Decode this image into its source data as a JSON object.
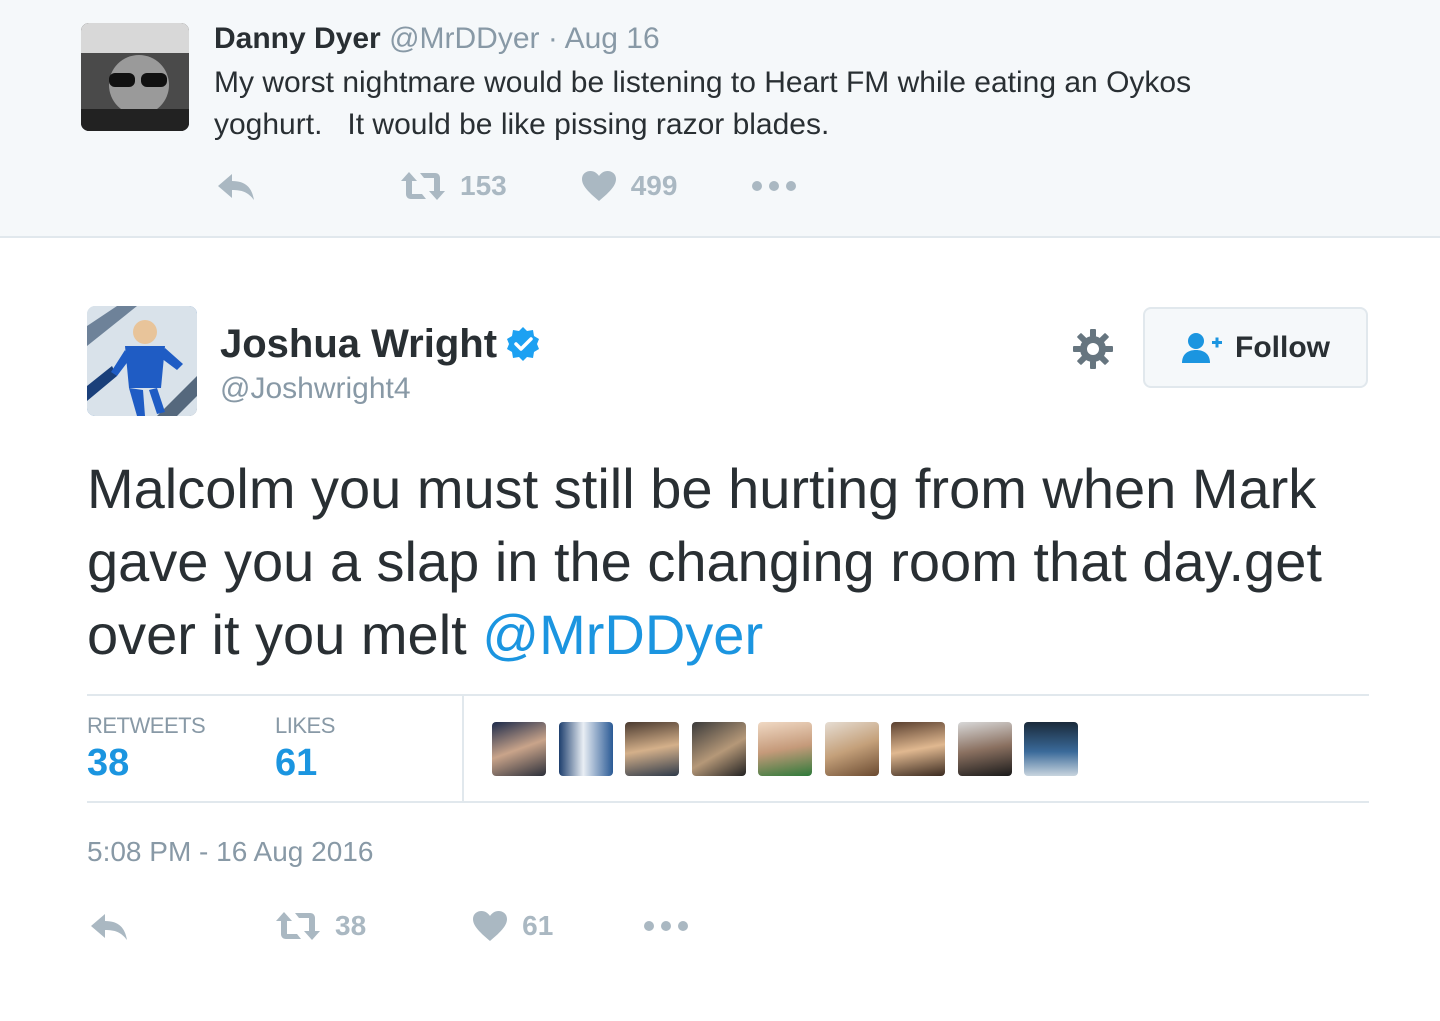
{
  "parent_tweet": {
    "name": "Danny Dyer",
    "handle": "@MrDDyer",
    "separator": "·",
    "date": "Aug 16",
    "text": "My worst nightmare would be listening to Heart FM while eating an Oykos\nyoghurt.   It would be like pissing razor blades.",
    "retweet_count": "153",
    "like_count": "499",
    "icons": [
      "reply-icon",
      "retweet-icon",
      "heart-icon",
      "more-icon"
    ]
  },
  "main_tweet": {
    "name": "Joshua Wright",
    "verified": true,
    "handle": "@Joshwright4",
    "follow_label": "Follow",
    "text": "Malcolm you must still be hurting from when Mark gave you a slap in the changing room that day.get over it you melt ",
    "mention": "@MrDDyer",
    "stats": {
      "retweets_label": "RETWEETS",
      "retweets_value": "38",
      "likes_label": "LIKES",
      "likes_value": "61"
    },
    "liker_avatar_count": 9,
    "timestamp": "5:08 PM - 16 Aug 2016",
    "action_retweet_count": "38",
    "action_like_count": "61"
  },
  "colors": {
    "link": "#1b95e0",
    "muted": "#8899a6",
    "action_icon": "#aab8c2",
    "text": "#292f33",
    "parent_background": "#f5f8fa",
    "border": "#e1e8ed",
    "verified_badge": "#1da1f2"
  }
}
